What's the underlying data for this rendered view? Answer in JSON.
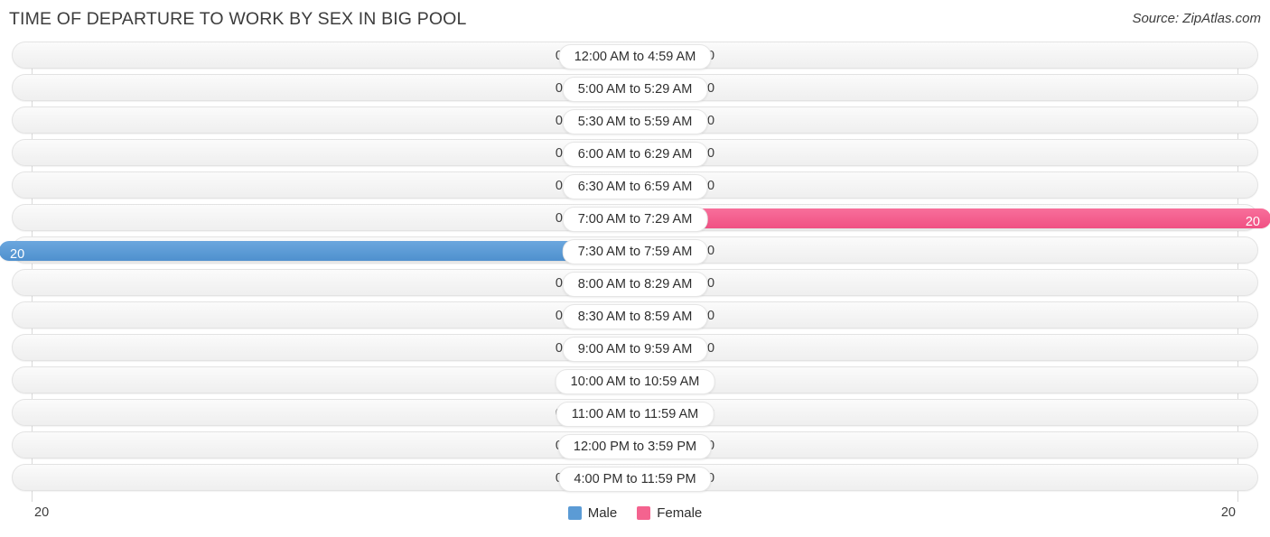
{
  "header": {
    "title": "TIME OF DEPARTURE TO WORK BY SEX IN BIG POOL",
    "source": "Source: ZipAtlas.com"
  },
  "footer": {
    "axis_left": "20",
    "axis_right": "20",
    "legend": [
      {
        "label": "Male",
        "color": "#5b9bd5"
      },
      {
        "label": "Female",
        "color": "#f4638f"
      }
    ]
  },
  "chart_data": {
    "type": "bar",
    "title": "TIME OF DEPARTURE TO WORK BY SEX IN BIG POOL",
    "orientation": "horizontal-diverging",
    "xlabel": "",
    "ylabel": "",
    "xlim": [
      20,
      20
    ],
    "grid": true,
    "legend_position": "bottom-center",
    "categories": [
      "12:00 AM to 4:59 AM",
      "5:00 AM to 5:29 AM",
      "5:30 AM to 5:59 AM",
      "6:00 AM to 6:29 AM",
      "6:30 AM to 6:59 AM",
      "7:00 AM to 7:29 AM",
      "7:30 AM to 7:59 AM",
      "8:00 AM to 8:29 AM",
      "8:30 AM to 8:59 AM",
      "9:00 AM to 9:59 AM",
      "10:00 AM to 10:59 AM",
      "11:00 AM to 11:59 AM",
      "12:00 PM to 3:59 PM",
      "4:00 PM to 11:59 PM"
    ],
    "series": [
      {
        "name": "Male",
        "color": "#5b9bd5",
        "values": [
          0,
          0,
          0,
          0,
          0,
          0,
          20,
          0,
          0,
          0,
          0,
          0,
          0,
          0
        ]
      },
      {
        "name": "Female",
        "color": "#f4638f",
        "values": [
          0,
          0,
          0,
          0,
          0,
          20,
          0,
          0,
          0,
          0,
          0,
          0,
          0,
          0
        ]
      }
    ],
    "rows": [
      {
        "category": "12:00 AM to 4:59 AM",
        "male": "0",
        "female": "0"
      },
      {
        "category": "5:00 AM to 5:29 AM",
        "male": "0",
        "female": "0"
      },
      {
        "category": "5:30 AM to 5:59 AM",
        "male": "0",
        "female": "0"
      },
      {
        "category": "6:00 AM to 6:29 AM",
        "male": "0",
        "female": "0"
      },
      {
        "category": "6:30 AM to 6:59 AM",
        "male": "0",
        "female": "0"
      },
      {
        "category": "7:00 AM to 7:29 AM",
        "male": "0",
        "female": "20"
      },
      {
        "category": "7:30 AM to 7:59 AM",
        "male": "20",
        "female": "0"
      },
      {
        "category": "8:00 AM to 8:29 AM",
        "male": "0",
        "female": "0"
      },
      {
        "category": "8:30 AM to 8:59 AM",
        "male": "0",
        "female": "0"
      },
      {
        "category": "9:00 AM to 9:59 AM",
        "male": "0",
        "female": "0"
      },
      {
        "category": "10:00 AM to 10:59 AM",
        "male": "0",
        "female": "0"
      },
      {
        "category": "11:00 AM to 11:59 AM",
        "male": "0",
        "female": "0"
      },
      {
        "category": "12:00 PM to 3:59 PM",
        "male": "0",
        "female": "0"
      },
      {
        "category": "4:00 PM to 11:59 PM",
        "male": "0",
        "female": "0"
      }
    ]
  }
}
